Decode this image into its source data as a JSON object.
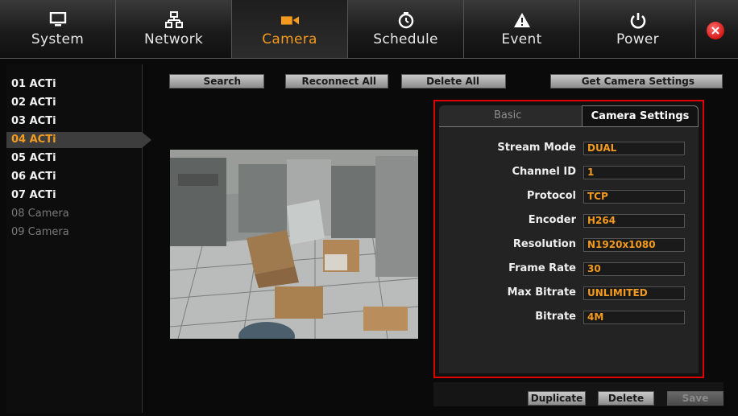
{
  "nav": {
    "tabs": [
      {
        "label": "System",
        "icon": "monitor-icon"
      },
      {
        "label": "Network",
        "icon": "network-icon"
      },
      {
        "label": "Camera",
        "icon": "camera-icon"
      },
      {
        "label": "Schedule",
        "icon": "clock-icon"
      },
      {
        "label": "Event",
        "icon": "warning-icon"
      },
      {
        "label": "Power",
        "icon": "power-icon"
      }
    ],
    "active_tab": "Camera",
    "accent_color": "#f39a1f",
    "close_color": "#d41818"
  },
  "cameras": [
    {
      "label": "01 ACTi"
    },
    {
      "label": "02 ACTi"
    },
    {
      "label": "03 ACTi"
    },
    {
      "label": "04 ACTi"
    },
    {
      "label": "05 ACTi"
    },
    {
      "label": "06 ACTi"
    },
    {
      "label": "07 ACTi"
    },
    {
      "label": "08 Camera"
    },
    {
      "label": "09 Camera"
    }
  ],
  "selected_camera": "04 ACTi",
  "toolbar": {
    "search": "Search",
    "reconnect_all": "Reconnect All",
    "delete_all": "Delete All",
    "get_settings": "Get Camera Settings"
  },
  "panel": {
    "tabs": {
      "basic": "Basic",
      "camera_settings": "Camera Settings"
    },
    "fields": [
      {
        "label": "Stream Mode",
        "value": "DUAL"
      },
      {
        "label": "Channel ID",
        "value": "1"
      },
      {
        "label": "Protocol",
        "value": "TCP"
      },
      {
        "label": "Encoder",
        "value": "H264"
      },
      {
        "label": "Resolution",
        "value": "N1920x1080"
      },
      {
        "label": "Frame Rate",
        "value": "30"
      },
      {
        "label": "Max Bitrate",
        "value": "UNLIMITED"
      },
      {
        "label": "Bitrate",
        "value": "4M"
      }
    ],
    "highlight_color": "#e00000"
  },
  "footer": {
    "duplicate": "Duplicate",
    "delete": "Delete",
    "save": "Save"
  }
}
